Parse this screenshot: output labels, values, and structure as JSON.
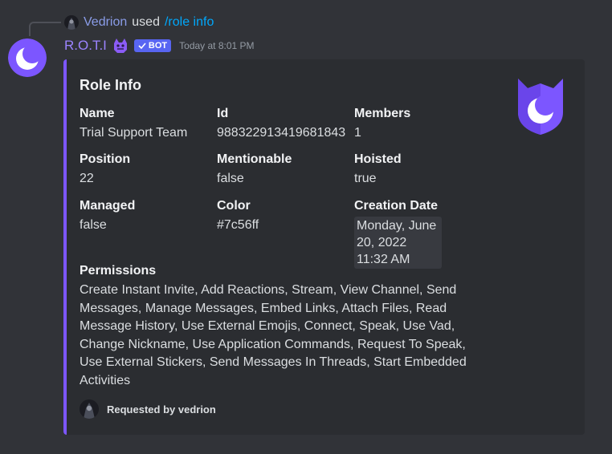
{
  "reply": {
    "user": "Vedrion",
    "used": "used",
    "command": "/role info"
  },
  "message": {
    "author": "R.O.T.I",
    "bot_tag": "BOT",
    "timestamp": "Today at 8:01 PM"
  },
  "embed": {
    "accent_color": "#7c56ff",
    "title": "Role Info",
    "fields": [
      {
        "name": "Name",
        "value": "Trial Support Team"
      },
      {
        "name": "Id",
        "value": "988322913419681843"
      },
      {
        "name": "Members",
        "value": "1"
      },
      {
        "name": "Position",
        "value": "22"
      },
      {
        "name": "Mentionable",
        "value": "false"
      },
      {
        "name": "Hoisted",
        "value": "true"
      },
      {
        "name": "Managed",
        "value": "false"
      },
      {
        "name": "Color",
        "value": "#7c56ff"
      },
      {
        "name": "Creation Date",
        "value": "Monday, June 20, 2022 11:32 AM"
      }
    ],
    "permissions": {
      "name": "Permissions",
      "value": "Create Instant Invite, Add Reactions, Stream, View Channel, Send Messages, Manage Messages, Embed Links, Attach Files, Read Message History, Use External Emojis, Connect, Speak, Use Vad, Change Nickname, Use Application Commands, Request To Speak, Use External Stickers, Send Messages In Threads, Start Embedded Activities"
    },
    "footer": {
      "text": "Requested by vedrion"
    }
  },
  "icons": [
    "shield-moon-thumbnail-icon",
    "moon-avatar-icon",
    "checkmark-icon",
    "purple-creature-emoji"
  ]
}
